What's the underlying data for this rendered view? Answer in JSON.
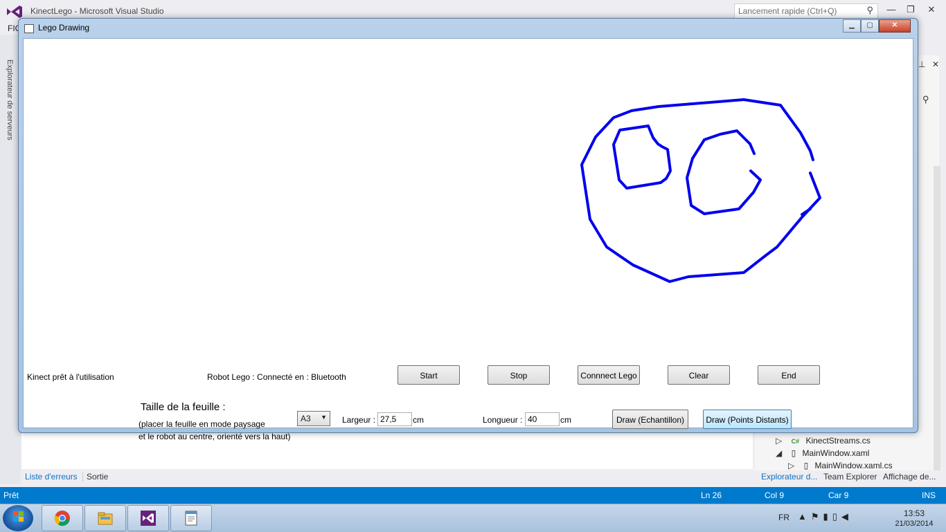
{
  "vs": {
    "title": "KinectLego - Microsoft Visual Studio",
    "quick_launch_placeholder": "Lancement rapide (Ctrl+Q)",
    "menu_stub": "FIC",
    "server_explorer_tab": "Explorateur de serveurs",
    "solution_items": [
      "KinectStreams.cs",
      "MainWindow.xaml",
      "MainWindow.xaml.cs"
    ],
    "bottom_tabs": [
      "Liste d'erreurs",
      "Sortie"
    ],
    "right_tabs": [
      "Explorateur d...",
      "Team Explorer",
      "Affichage de..."
    ],
    "status": {
      "ready": "Prêt",
      "line": "Ln 26",
      "col": "Col 9",
      "char": "Car 9",
      "mode": "INS"
    }
  },
  "taskbar": {
    "apps": [
      "chrome-icon",
      "file-explorer-icon",
      "visual-studio-icon",
      "notepad-icon"
    ],
    "language": "FR",
    "time": "13:53",
    "date": "21/03/2014"
  },
  "lego_window": {
    "title": "Lego Drawing",
    "kinect_status": "Kinect prêt à l'utilisation",
    "robot_status": "Robot Lego : Connecté en : Bluetooth",
    "buttons": {
      "start": "Start",
      "stop": "Stop",
      "connect": "Connnect Lego",
      "clear": "Clear",
      "end": "End",
      "draw_sample": "Draw (Echantillon)",
      "draw_distant": "Draw (Points Distants)"
    },
    "sheet": {
      "title": "Taille de la feuille :",
      "hint_line1": "(placer la feuille en mode paysage",
      "hint_line2": "et le robot au centre, orienté vers la haut)",
      "size_selected": "A3",
      "width_label": "Largeur :",
      "width_value": "27,5",
      "width_unit": "cm",
      "length_label": "Longueur :",
      "length_value": "40",
      "length_unit": "cm"
    },
    "stroke_color": "#0000ee"
  }
}
